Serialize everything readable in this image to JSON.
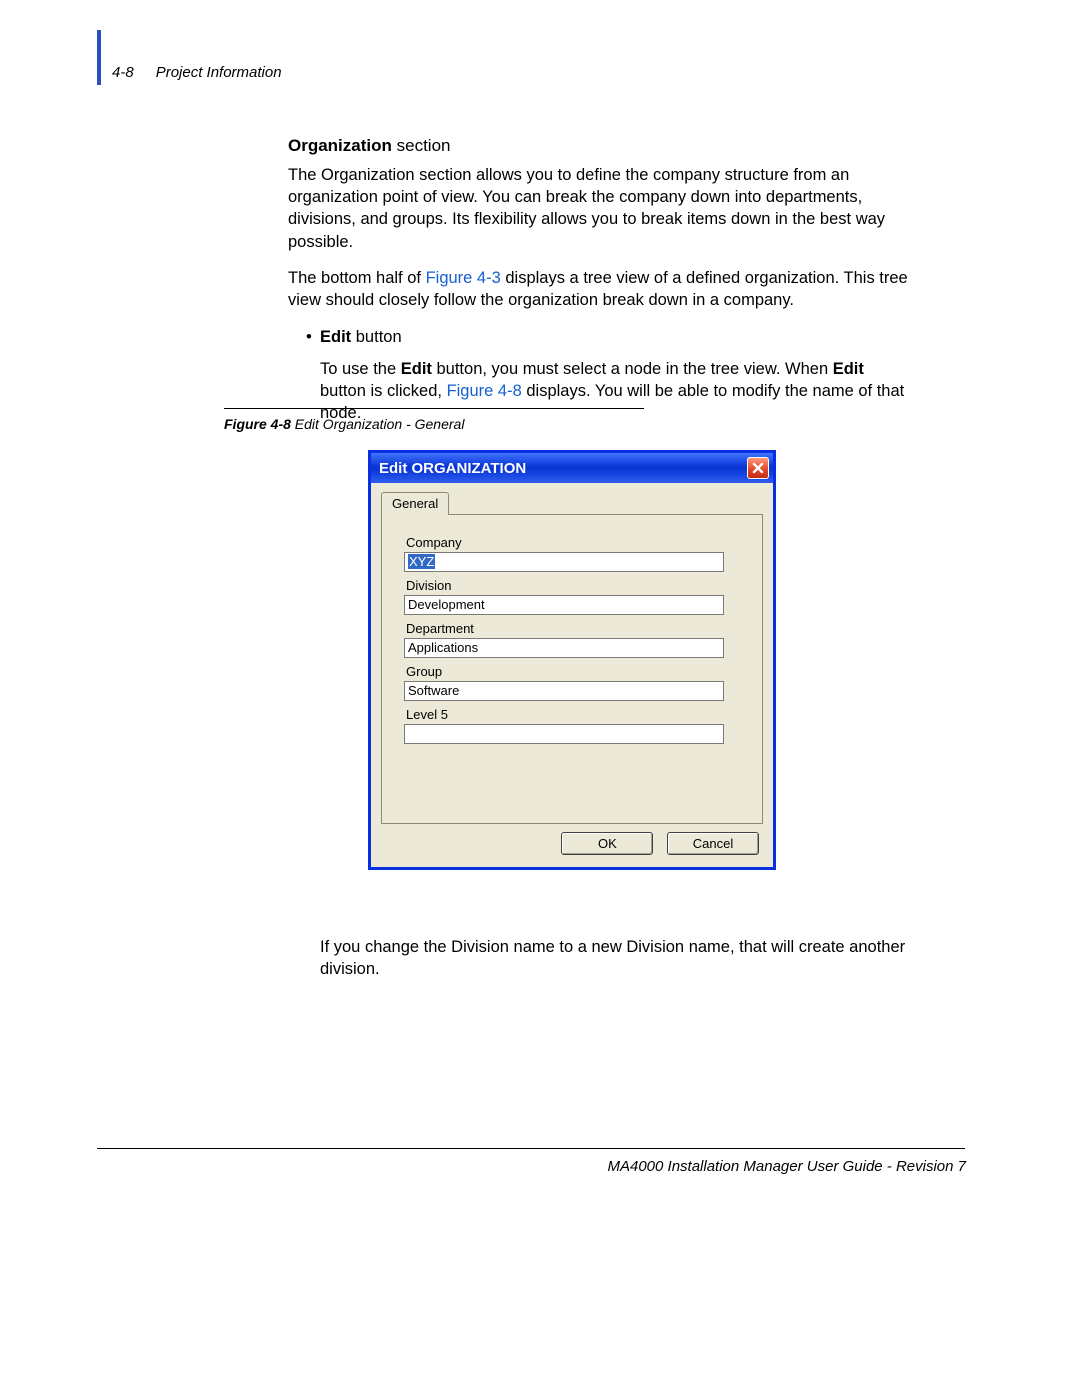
{
  "header": {
    "page_no": "4-8",
    "section": "Project Information"
  },
  "section": {
    "title_bold": "Organization",
    "title_rest": " section",
    "p1": "The Organization section allows you to define the company structure from an organization point of view. You can break the company down into departments, divisions, and groups. Its flexibility allows you to break items down in the best way possible.",
    "p2a": "The bottom half of ",
    "p2_link": "Figure 4-3",
    "p2b": " displays a tree view of a defined organization. This tree view should closely follow the organization break down in a company.",
    "bullet_bold": "Edit",
    "bullet_rest": " button",
    "p3a": "To use the ",
    "p3_b1": "Edit",
    "p3b": " button, you must select a node in the tree view. When ",
    "p3_b2": "Edit",
    "p3c": " button is clicked, ",
    "p3_link": "Figure 4-8",
    "p3d": " displays. You will be able to modify the name of that node."
  },
  "figure": {
    "label": "Figure 4-8",
    "caption": "  Edit Organization - General"
  },
  "dialog": {
    "title": "Edit ORGANIZATION",
    "tab": "General",
    "fields": {
      "company_label": "Company",
      "company_value": "XYZ",
      "division_label": "Division",
      "division_value": "Development",
      "department_label": "Department",
      "department_value": "Applications",
      "group_label": "Group",
      "group_value": "Software",
      "level5_label": "Level 5",
      "level5_value": ""
    },
    "buttons": {
      "ok": "OK",
      "cancel": "Cancel"
    }
  },
  "after_fig": "If you change the Division name to a new Division name, that will create another division.",
  "footer": "MA4000 Installation Manager User Guide - Revision 7"
}
